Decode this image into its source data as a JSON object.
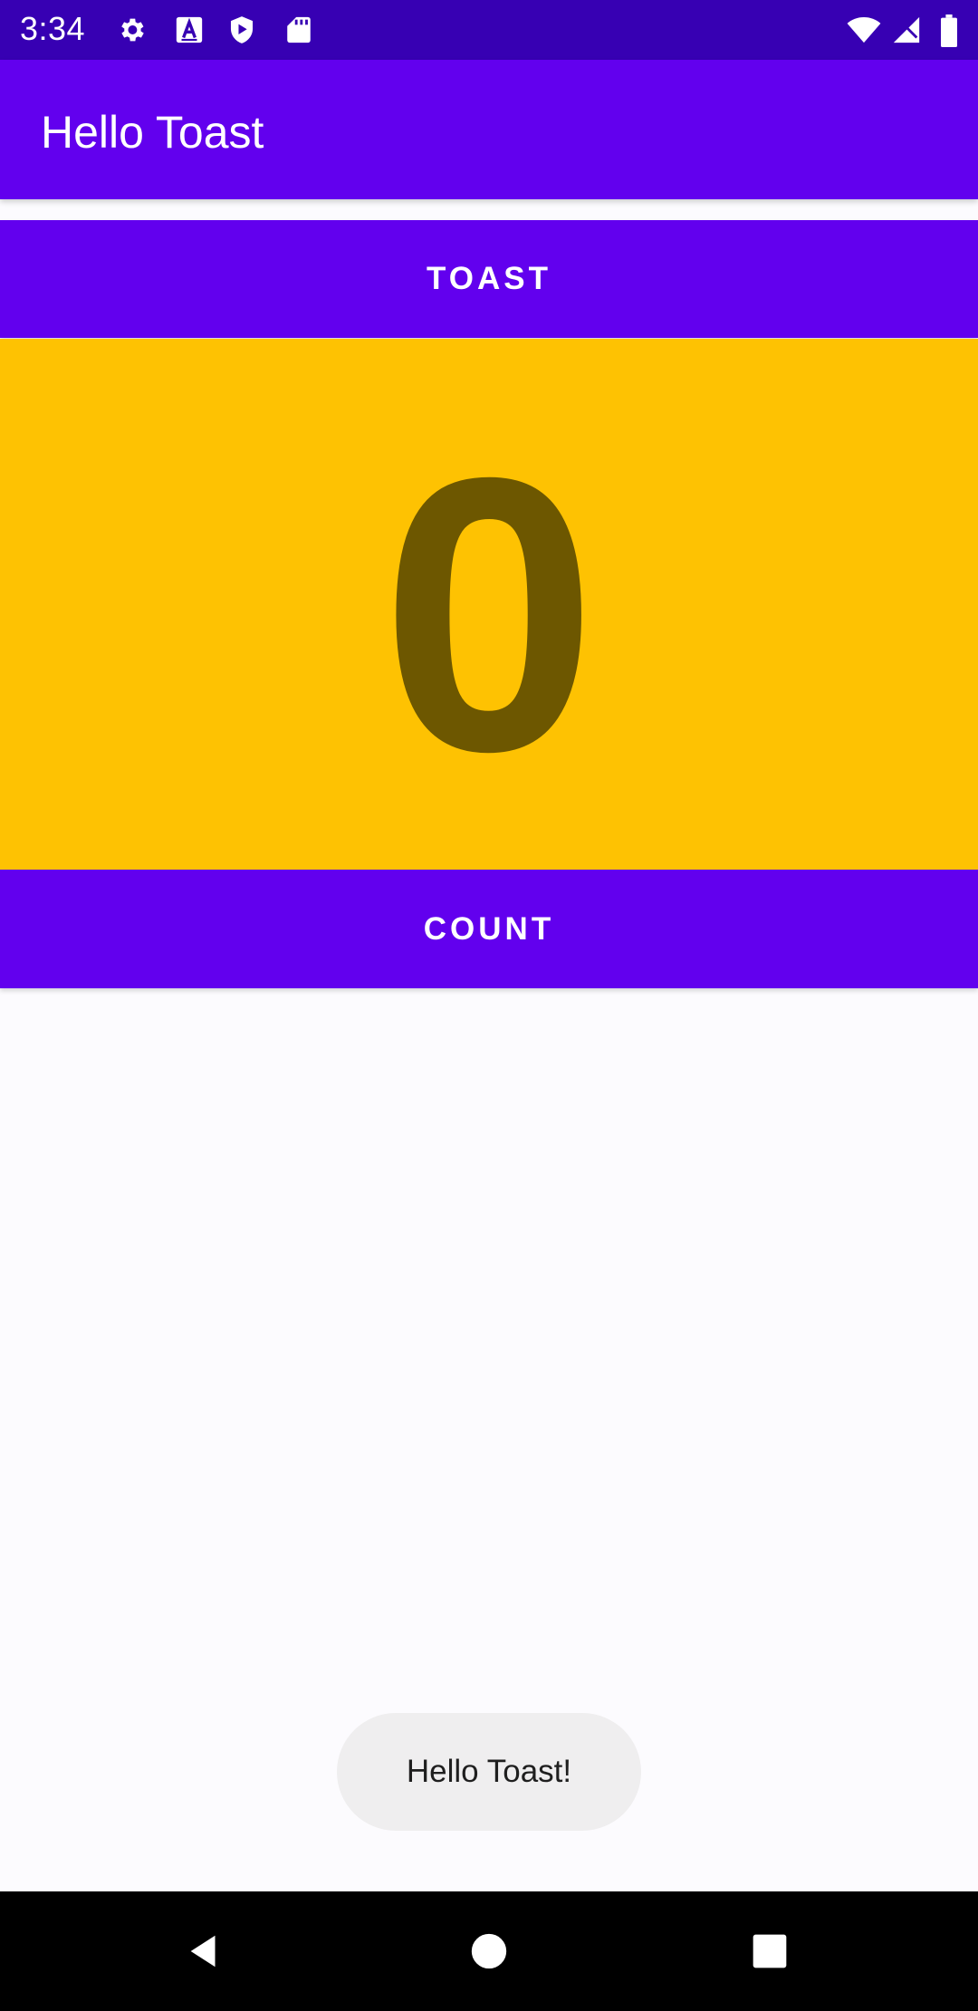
{
  "status_bar": {
    "time": "3:34",
    "icons": [
      "gear-icon",
      "a-box-icon",
      "play-shield-icon",
      "sd-card-icon",
      "wifi-icon",
      "signal-icon",
      "battery-icon"
    ]
  },
  "app_bar": {
    "title": "Hello Toast"
  },
  "buttons": {
    "toast_label": "TOAST",
    "count_label": "COUNT"
  },
  "counter": {
    "value": "0"
  },
  "toast": {
    "message": "Hello Toast!"
  },
  "nav_bar": {
    "icons": [
      "back-triangle-icon",
      "home-circle-icon",
      "recents-square-icon"
    ]
  },
  "colors": {
    "status_bar": "#3700b3",
    "primary": "#6200ee",
    "counter_background": "#fec202",
    "counter_text": "#6d5700",
    "toast_background": "#efeeef",
    "nav_bar": "#000000"
  }
}
